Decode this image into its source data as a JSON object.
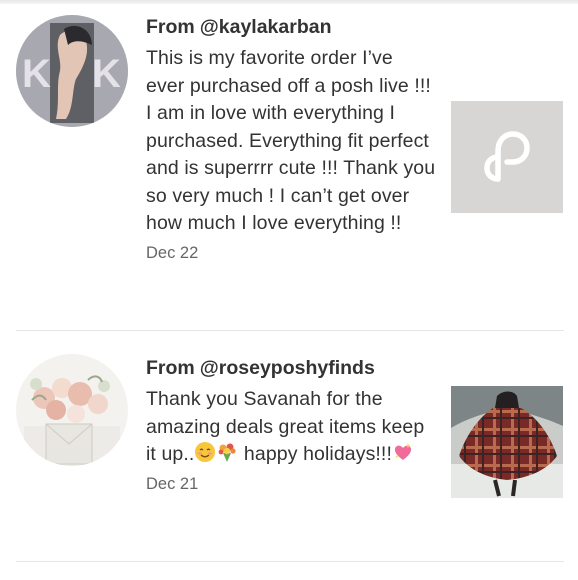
{
  "reviews": [
    {
      "from_prefix": "From",
      "handle": "@kaylakarban",
      "text": "This is my favorite order I’ve ever purchased off a posh live !!! I am in love with everything I purchased. Everything fit perfect and is superrrr cute !!! Thank you so very much ! I can’t get over how much I love everything !!",
      "date": "Dec 22",
      "avatar_letters": "K K",
      "thumbnail_icon": "poshmark-logo-icon"
    },
    {
      "from_prefix": "From",
      "handle": "@roseyposhyfinds",
      "text_part1": "Thank you Savanah for the amazing deals great items keep it up..",
      "text_part2": " happy holidays!!!",
      "emojis": [
        "smiling-face-icon",
        "bouquet-icon",
        "sparkling-heart-icon"
      ],
      "date": "Dec 21",
      "avatar_icon": "flower-bouquet-avatar",
      "thumbnail_icon": "plaid-poncho-photo"
    }
  ],
  "colors": {
    "text": "#333333",
    "date": "#666666",
    "divider": "#e6e6e6",
    "thumb_placeholder": "#d8d6d5"
  }
}
